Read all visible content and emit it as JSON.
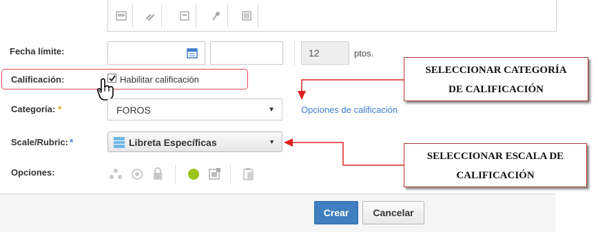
{
  "toolbar": {
    "icons": [
      "image-icon",
      "link-icon",
      "archive-icon",
      "microphone-icon",
      "attachment-icon"
    ]
  },
  "fecha": {
    "label": "Fecha límite:",
    "date_value": "",
    "time_value": "",
    "points_value": "12",
    "points_unit": "ptos."
  },
  "calificacion": {
    "label": "Calificación:",
    "checkbox_label": "Habilitar calificación",
    "checked": true
  },
  "categoria": {
    "label": "Categoría:",
    "required_mark": "*",
    "selected": "FOROS",
    "options_link": "Opciones de calificación"
  },
  "scale": {
    "label": "Scale/Rubric:",
    "required_mark": "*",
    "selected": "Libreta Específicas"
  },
  "opciones": {
    "label": "Opciones:"
  },
  "callouts": {
    "categoria_line1": "SELECCIONAR CATEGORÍA",
    "categoria_line2": "DE CALIFICACIÓN",
    "escala_line1": "SELECCIONAR ESCALA DE",
    "escala_line2": "CALIFICACIÓN"
  },
  "footer": {
    "create_label": "Crear",
    "cancel_label": "Cancelar"
  },
  "colors": {
    "primary": "#3f7fbf",
    "link": "#3b7bd4",
    "highlight": "#e0454f",
    "arrow": "#e02020",
    "status_green": "#9bc31c"
  }
}
